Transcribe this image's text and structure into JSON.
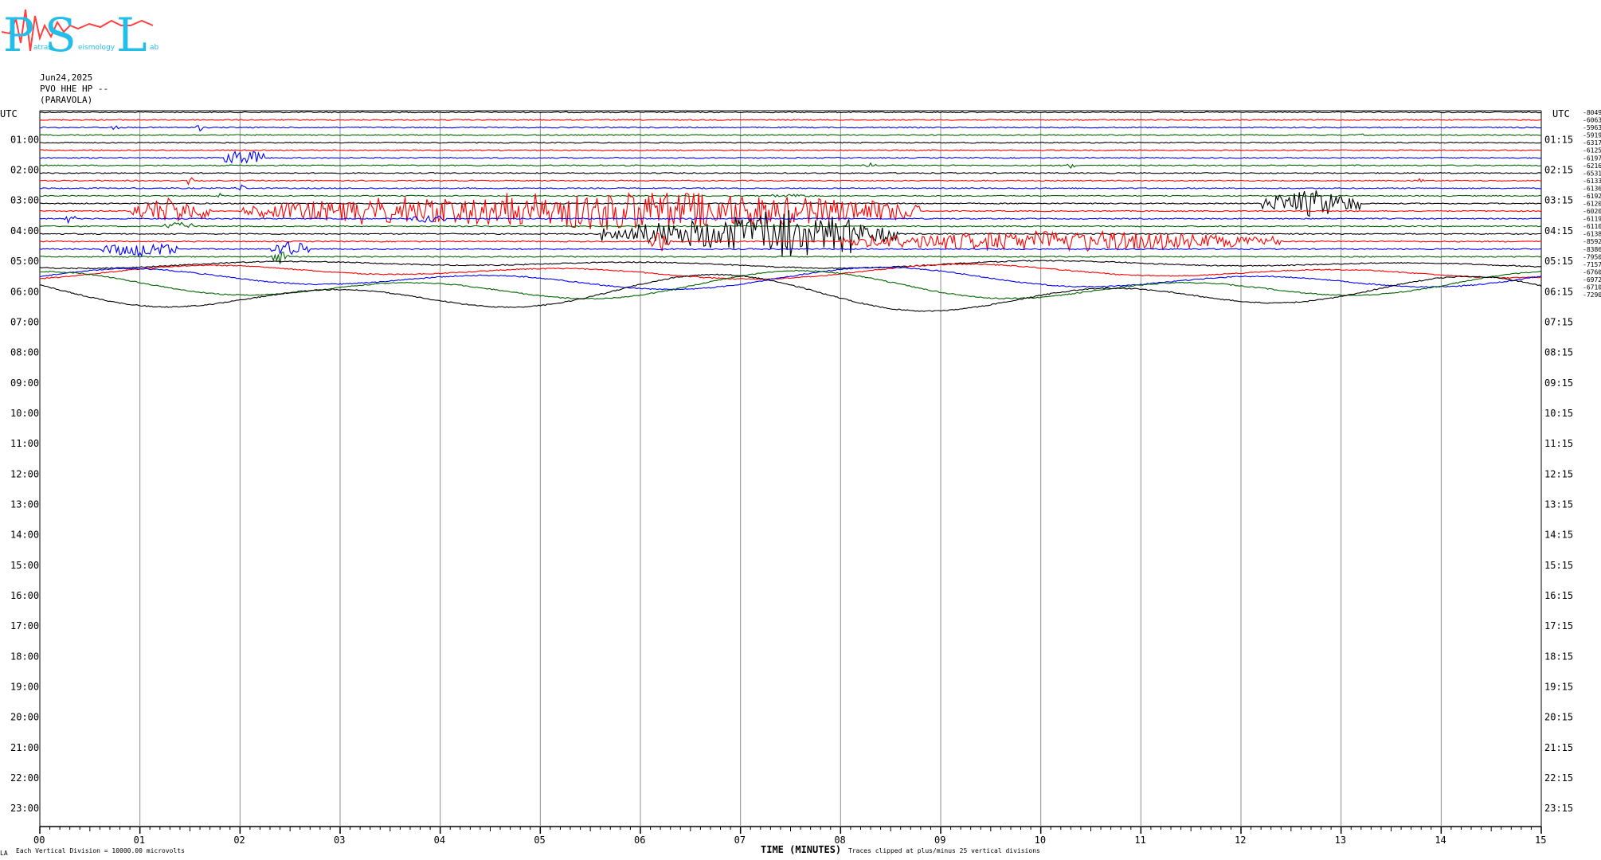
{
  "logo": {
    "big_letters": [
      "P",
      "S",
      "L"
    ],
    "small_words": [
      "atras",
      "eismology",
      "ab"
    ],
    "colors": {
      "cyan": "#22bde8",
      "red": "#ff3c3c"
    }
  },
  "header": {
    "date": "Jun24,2025",
    "station": "PVO HHE HP --",
    "place": "(PARAVOLA)"
  },
  "chart_data": {
    "type": "seismogram",
    "trace_colors": [
      "#000000",
      "#ff0000",
      "#0000ff",
      "#006400"
    ],
    "left_axis_label": "UTC",
    "right_axis_label": "UTC",
    "left_hour_labels": [
      "01:00",
      "02:00",
      "03:00",
      "04:00",
      "05:00",
      "06:00",
      "07:00",
      "08:00",
      "09:00",
      "10:00",
      "11:00",
      "12:00",
      "13:00",
      "14:00",
      "15:00",
      "16:00",
      "17:00",
      "18:00",
      "19:00",
      "20:00",
      "21:00",
      "22:00",
      "23:00"
    ],
    "right_hour_labels": [
      "01:15",
      "02:15",
      "03:15",
      "04:15",
      "05:15",
      "06:15",
      "07:15",
      "08:15",
      "09:15",
      "10:15",
      "11:15",
      "12:15",
      "13:15",
      "14:15",
      "15:15",
      "16:15",
      "17:15",
      "18:15",
      "19:15",
      "20:15",
      "21:15",
      "22:15",
      "23:15"
    ],
    "trace_offsets": [
      "-8049",
      "-6063",
      "-5963",
      "-5919",
      "-6317",
      "-6125",
      "-6197",
      "-6216",
      "-6531",
      "-6133",
      "-6136",
      "-6192",
      "-6120",
      "-6020",
      "-6119",
      "-6110",
      "-6138",
      "-8592",
      "-8386",
      "-7950",
      "-7157",
      "-6760",
      "-6972",
      "-6710",
      "-7290"
    ],
    "x_ticks": [
      "00",
      "01",
      "02",
      "03",
      "04",
      "05",
      "06",
      "07",
      "08",
      "09",
      "10",
      "11",
      "12",
      "13",
      "14",
      "15"
    ],
    "x_range": [
      0,
      15
    ],
    "xlabel": "TIME (MINUTES)",
    "grid": true,
    "traces_plotted": 25,
    "rows_total": 94
  },
  "footer": {
    "left_note": "Each Vertical Division = 10000.00 microvolts",
    "clip_note": "Traces clipped at plus/minus 25 vertical divisions",
    "corner_mark": "LA"
  }
}
